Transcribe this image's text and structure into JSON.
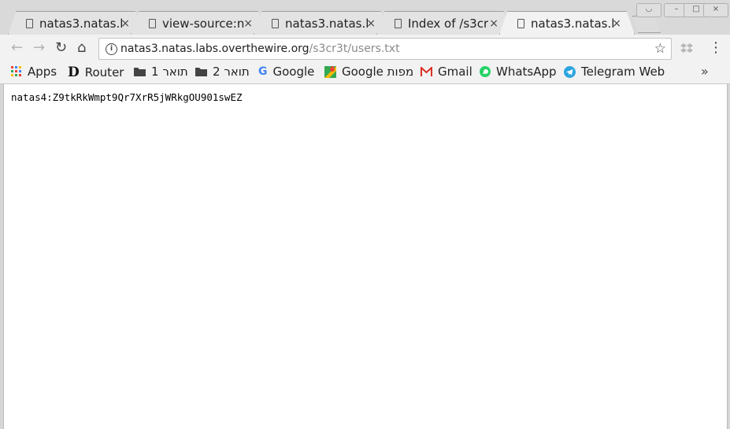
{
  "tabs": [
    {
      "title": "natas3.natas.l",
      "active": false
    },
    {
      "title": "view-source:n",
      "active": false
    },
    {
      "title": "natas3.natas.l",
      "active": false
    },
    {
      "title": "Index of /s3cr",
      "active": false
    },
    {
      "title": "natas3.natas.l",
      "active": true
    }
  ],
  "tab_close_glyph": "×",
  "address": {
    "host": "natas3.natas.labs.overthewire.org",
    "path": "/s3cr3t/users.txt"
  },
  "bookmarks": [
    {
      "label": "Apps",
      "icon": "apps-grid-icon"
    },
    {
      "label": "Router",
      "icon": "d-link-icon"
    },
    {
      "label": "תואר 1",
      "icon": "folder-icon"
    },
    {
      "label": "תואר 2",
      "icon": "folder-icon"
    },
    {
      "label": "Google",
      "icon": "google-icon"
    },
    {
      "label": "Google מפות",
      "icon": "google-maps-icon"
    },
    {
      "label": "Gmail",
      "icon": "gmail-icon"
    },
    {
      "label": "WhatsApp",
      "icon": "whatsapp-icon"
    },
    {
      "label": "Telegram Web",
      "icon": "telegram-icon"
    }
  ],
  "bookmarks_overflow": "»",
  "page_text": "natas4:Z9tkRkWmpt9Qr7XrR5jWRkgOU901swEZ",
  "colors": {
    "gmail": "#d93025",
    "whatsapp": "#25d366",
    "telegram": "#2ca5e0",
    "google_blue": "#4285f4"
  }
}
